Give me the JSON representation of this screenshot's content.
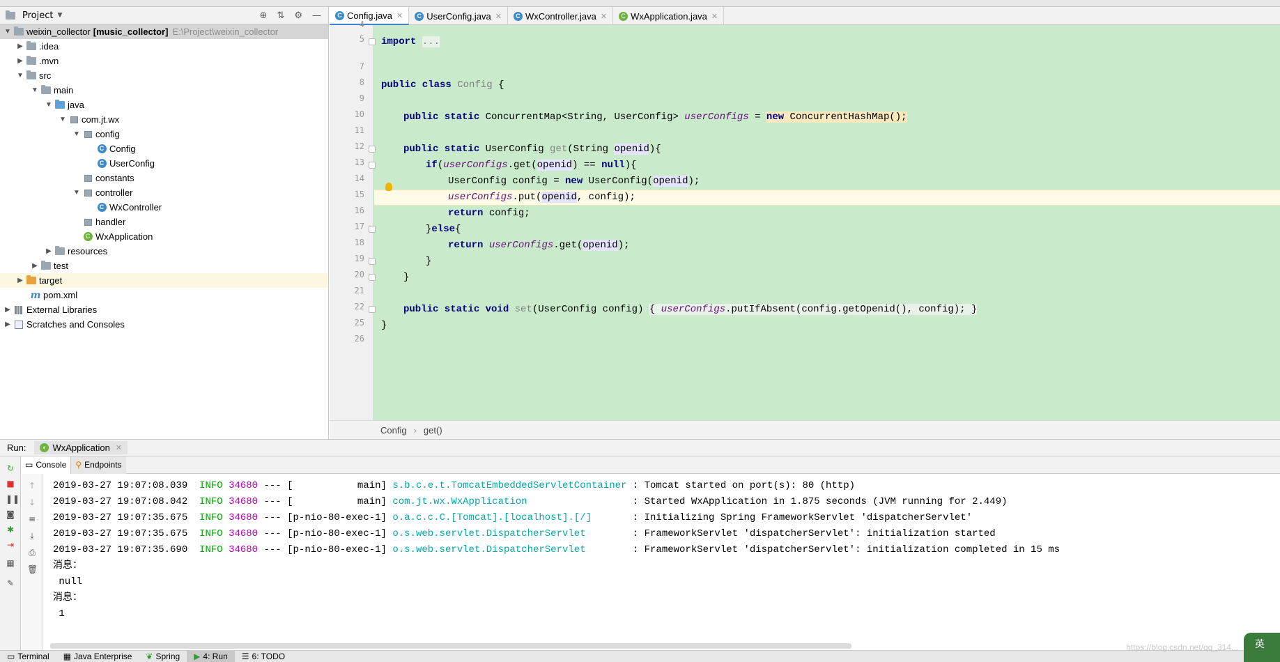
{
  "project": {
    "title": "Project",
    "tree": [
      {
        "label": "weixin_collector",
        "module": "[music_collector]",
        "path": "E:\\Project\\weixin_collector"
      },
      {
        "label": ".idea"
      },
      {
        "label": ".mvn"
      },
      {
        "label": "src"
      },
      {
        "label": "main"
      },
      {
        "label": "java"
      },
      {
        "label": "com.jt.wx"
      },
      {
        "label": "config"
      },
      {
        "label": "Config"
      },
      {
        "label": "UserConfig"
      },
      {
        "label": "constants"
      },
      {
        "label": "controller"
      },
      {
        "label": "WxController"
      },
      {
        "label": "handler"
      },
      {
        "label": "WxApplication"
      },
      {
        "label": "resources"
      },
      {
        "label": "test"
      },
      {
        "label": "target"
      },
      {
        "label": "pom.xml"
      },
      {
        "label": "External Libraries"
      },
      {
        "label": "Scratches and Consoles"
      }
    ]
  },
  "tabs": [
    {
      "label": "Config.java",
      "active": true
    },
    {
      "label": "UserConfig.java"
    },
    {
      "label": "WxController.java"
    },
    {
      "label": "WxApplication.java"
    }
  ],
  "editor": {
    "line_numbers": [
      "4",
      "5",
      "7",
      "8",
      "9",
      "10",
      "11",
      "12",
      "13",
      "14",
      "15",
      "16",
      "17",
      "18",
      "19",
      "20",
      "21",
      "22",
      "25",
      "26"
    ],
    "code": {
      "import_kw": "import",
      "import_fold": "...",
      "class_mods": "public class",
      "class_name": "Config",
      "brace_open": "{",
      "l10_mods": "public static",
      "l10_type": "ConcurrentMap<String, UserConfig>",
      "l10_field": "userConfigs",
      "l10_eq": " = ",
      "l10_new": "new",
      "l10_ctor": "ConcurrentHashMap();",
      "l12_mods": "public static",
      "l12_type": "UserConfig",
      "l12_name": "get",
      "l12_sig": "(String ",
      "l12_param": "openid",
      "l12_end": "){",
      "l13_if": "if",
      "l13_a": "(",
      "l13_field": "userConfigs",
      "l13_b": ".get(",
      "l13_param": "openid",
      "l13_c": ") == ",
      "l13_null": "null",
      "l13_d": "){",
      "l14_a": "UserConfig config = ",
      "l14_new": "new",
      "l14_b": " UserConfig(",
      "l14_param": "openid",
      "l14_c": ");",
      "l15_field": "userConfigs",
      "l15_a": ".put(",
      "l15_param": "openid",
      "l15_b": ", config);",
      "l16_return": "return",
      "l16_a": " config;",
      "l17_a": "}",
      "l17_else": "else",
      "l17_b": "{",
      "l18_return": "return",
      "l18_field": "userConfigs",
      "l18_a": ".get(",
      "l18_param": "openid",
      "l18_b": ");",
      "l19": "}",
      "l20": "}",
      "l22_mods": "public static void",
      "l22_name": "set",
      "l22_a": "(UserConfig config) ",
      "l22_b": "{ ",
      "l22_field": "userConfigs",
      "l22_c": ".putIfAbsent(config.getOpenid(), config); }",
      "l25": "}"
    }
  },
  "breadcrumb": [
    "Config",
    "get()"
  ],
  "run": {
    "label": "Run:",
    "config_name": "WxApplication",
    "subtabs": [
      "Console",
      "Endpoints"
    ],
    "log": [
      {
        "ts": "2019-03-27 19:07:08.039",
        "level": "INFO",
        "pid": "34680",
        "sep": "---",
        "thread": "[           main]",
        "logger": "s.b.c.e.t.TomcatEmbeddedServletContainer",
        "msg": ": Tomcat started on port(s): 80 (http)"
      },
      {
        "ts": "2019-03-27 19:07:08.042",
        "level": "INFO",
        "pid": "34680",
        "sep": "---",
        "thread": "[           main]",
        "logger": "com.jt.wx.WxApplication                 ",
        "msg": ": Started WxApplication in 1.875 seconds (JVM running for 2.449)"
      },
      {
        "ts": "2019-03-27 19:07:35.675",
        "level": "INFO",
        "pid": "34680",
        "sep": "---",
        "thread": "[p-nio-80-exec-1]",
        "logger": "o.a.c.c.C.[Tomcat].[localhost].[/]      ",
        "msg": ": Initializing Spring FrameworkServlet 'dispatcherServlet'"
      },
      {
        "ts": "2019-03-27 19:07:35.675",
        "level": "INFO",
        "pid": "34680",
        "sep": "---",
        "thread": "[p-nio-80-exec-1]",
        "logger": "o.s.web.servlet.DispatcherServlet       ",
        "msg": ": FrameworkServlet 'dispatcherServlet': initialization started"
      },
      {
        "ts": "2019-03-27 19:07:35.690",
        "level": "INFO",
        "pid": "34680",
        "sep": "---",
        "thread": "[p-nio-80-exec-1]",
        "logger": "o.s.web.servlet.DispatcherServlet       ",
        "msg": ": FrameworkServlet 'dispatcherServlet': initialization completed in 15 ms"
      }
    ],
    "plain": [
      "消息：",
      " null",
      "消息：",
      " 1"
    ]
  },
  "bottom_tabs": [
    "Terminal",
    "Java Enterprise",
    "Spring",
    "4: Run",
    "6: TODO"
  ],
  "watermark": "https://blog.csdn.net/qq_314...",
  "ime": "英"
}
